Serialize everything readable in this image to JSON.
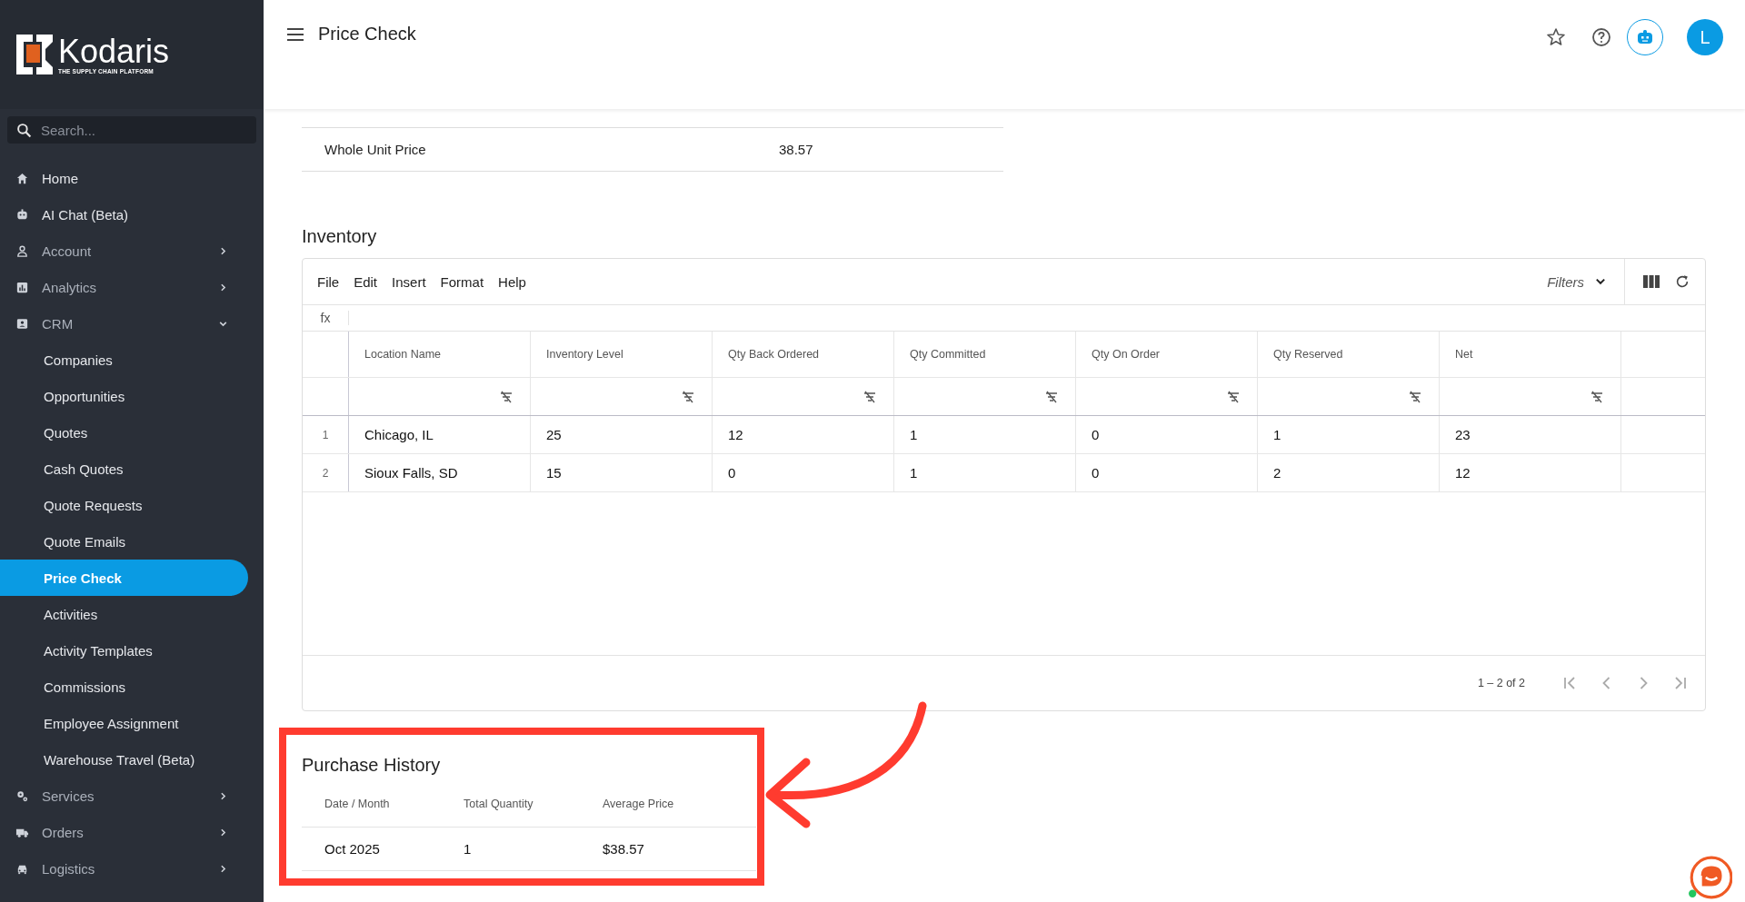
{
  "brand": {
    "name": "Kodaris",
    "tagline": "THE SUPPLY CHAIN PLATFORM"
  },
  "search": {
    "placeholder": "Search..."
  },
  "nav": [
    {
      "label": "Home",
      "selected": false
    },
    {
      "label": "AI Chat (Beta)",
      "selected": false
    },
    {
      "label": "Account",
      "selected": false,
      "expanded": false
    },
    {
      "label": "Analytics",
      "selected": false,
      "expanded": false
    },
    {
      "label": "CRM",
      "selected": false,
      "expanded": true,
      "children": [
        {
          "label": "Companies",
          "selected": false
        },
        {
          "label": "Opportunities",
          "selected": false
        },
        {
          "label": "Quotes",
          "selected": false
        },
        {
          "label": "Cash Quotes",
          "selected": false
        },
        {
          "label": "Quote Requests",
          "selected": false
        },
        {
          "label": "Quote Emails",
          "selected": false
        },
        {
          "label": "Price Check",
          "selected": true
        },
        {
          "label": "Activities",
          "selected": false
        },
        {
          "label": "Activity Templates",
          "selected": false
        },
        {
          "label": "Commissions",
          "selected": false
        },
        {
          "label": "Employee Assignment",
          "selected": false
        },
        {
          "label": "Warehouse Travel (Beta)",
          "selected": false
        }
      ]
    },
    {
      "label": "Services",
      "selected": false,
      "expanded": false
    },
    {
      "label": "Orders",
      "selected": false,
      "expanded": false
    },
    {
      "label": "Logistics",
      "selected": false,
      "expanded": false
    }
  ],
  "header": {
    "title": "Price Check",
    "avatar": "L"
  },
  "price_rows": [
    {
      "label": "Whole Unit Price",
      "value": "38.57"
    }
  ],
  "inventory": {
    "title": "Inventory",
    "menu": [
      "File",
      "Edit",
      "Insert",
      "Format",
      "Help"
    ],
    "filters": "Filters",
    "formula_label": "fx",
    "columns": [
      "Location Name",
      "Inventory Level",
      "Qty Back Ordered",
      "Qty Committed",
      "Qty On Order",
      "Qty Reserved",
      "Net"
    ],
    "rows": [
      {
        "number": "1",
        "cells": [
          "Chicago, IL",
          "25",
          "12",
          "1",
          "0",
          "1",
          "23"
        ]
      },
      {
        "number": "2",
        "cells": [
          "Sioux Falls, SD",
          "15",
          "0",
          "1",
          "0",
          "2",
          "12"
        ]
      }
    ],
    "pagination": "1 – 2 of 2"
  },
  "purchase_history": {
    "title": "Purchase History",
    "columns": [
      "Date / Month",
      "Total Quantity",
      "Average Price"
    ],
    "rows": [
      [
        "Oct 2025",
        "1",
        "$38.57"
      ]
    ]
  }
}
